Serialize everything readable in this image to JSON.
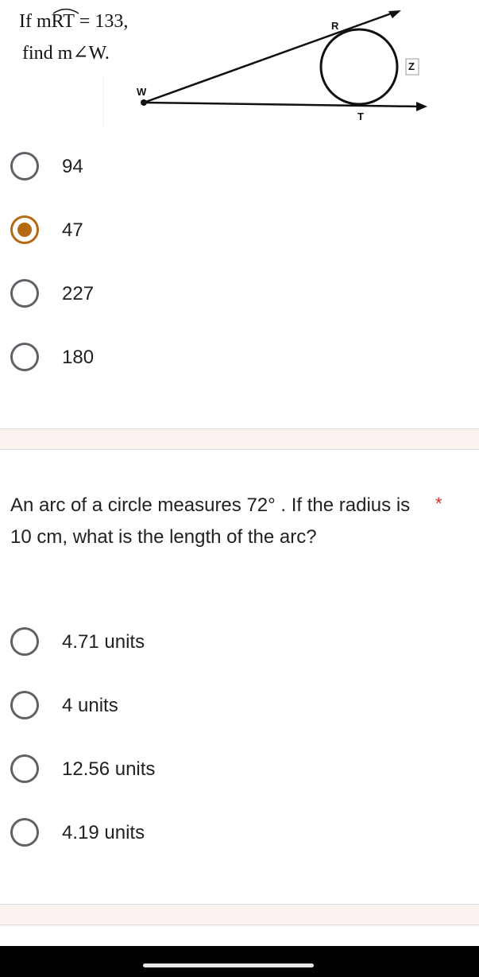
{
  "question1": {
    "figure": {
      "line1_prefix": "If m",
      "arc_letters": "RT",
      "line1_suffix": " = 133,",
      "line2": "find m∠W.",
      "labels": {
        "r": "R",
        "z": "Z",
        "w": "W",
        "t": "T"
      }
    },
    "options": [
      {
        "label": "94",
        "selected": false
      },
      {
        "label": "47",
        "selected": true
      },
      {
        "label": "227",
        "selected": false
      },
      {
        "label": "180",
        "selected": false
      }
    ]
  },
  "question2": {
    "text": "An arc of a circle measures 72° . If the radius is 10 cm, what is the length of the arc?",
    "required_mark": "*",
    "options": [
      {
        "label": "4.71 units",
        "selected": false
      },
      {
        "label": "4 units",
        "selected": false
      },
      {
        "label": "12.56 units",
        "selected": false
      },
      {
        "label": "4.19 units",
        "selected": false
      }
    ]
  },
  "colors": {
    "accent": "#b36a12",
    "radio_border": "#5f6368",
    "section_gap": "#fbf3ef",
    "required": "#d93025"
  }
}
